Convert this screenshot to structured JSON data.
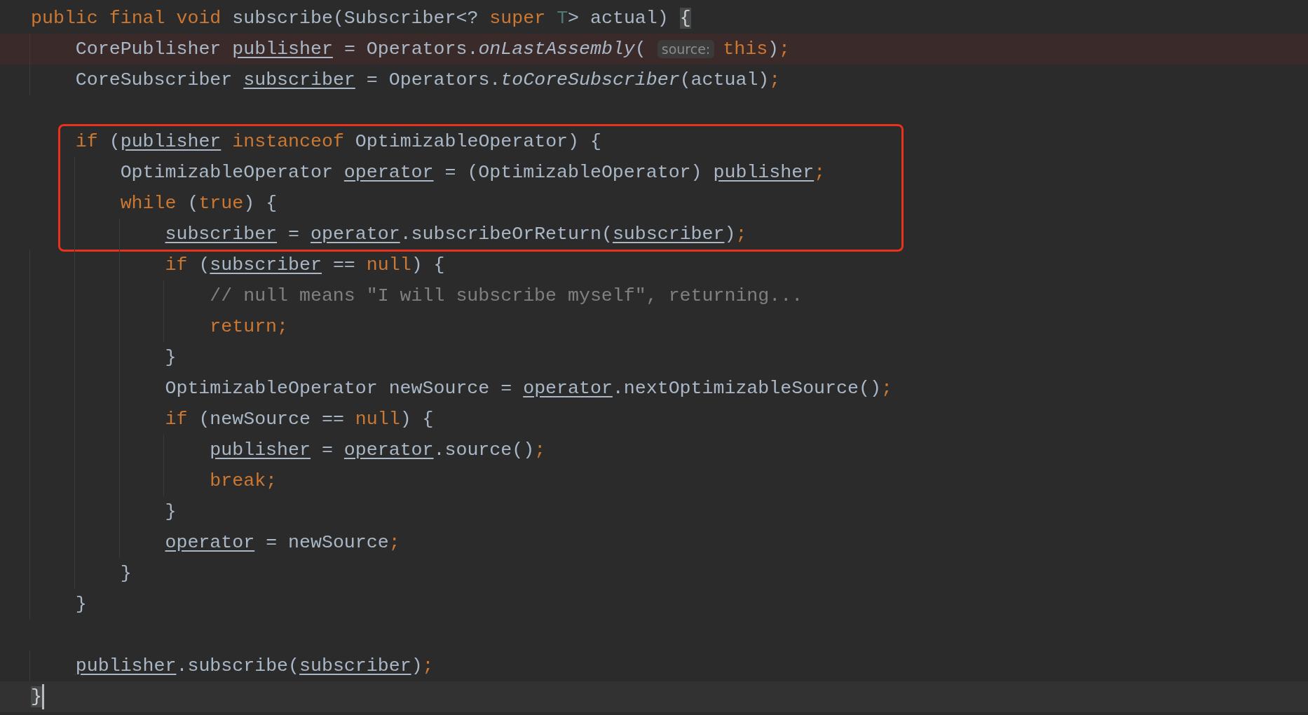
{
  "editor": {
    "lines": [
      {
        "kind": "code",
        "tokens": [
          {
            "kind": "keyword",
            "text": "public final void"
          },
          {
            "kind": "plain",
            "text": " subscribe(Subscriber<? "
          },
          {
            "kind": "keyword",
            "text": "super"
          },
          {
            "kind": "type-param",
            "text": " T"
          },
          {
            "kind": "plain",
            "text": "> actual) "
          },
          {
            "kind": "brace-match",
            "text": "{"
          }
        ],
        "children": [
          {
            "kind": "code",
            "marked": true,
            "tokens": [
              {
                "kind": "plain",
                "text": "CorePublisher "
              },
              {
                "kind": "local",
                "text": "publisher"
              },
              {
                "kind": "plain",
                "text": " = Operators."
              },
              {
                "kind": "static-call",
                "text": "onLastAssembly"
              },
              {
                "kind": "plain",
                "text": "( "
              },
              {
                "kind": "hint",
                "text": "source:"
              },
              {
                "kind": "keyword",
                "text": "this"
              },
              {
                "kind": "plain",
                "text": ")"
              },
              {
                "kind": "semicolon",
                "text": ";"
              }
            ]
          },
          {
            "kind": "code",
            "tokens": [
              {
                "kind": "plain",
                "text": "CoreSubscriber "
              },
              {
                "kind": "local",
                "text": "subscriber"
              },
              {
                "kind": "plain",
                "text": " = Operators."
              },
              {
                "kind": "static-call",
                "text": "toCoreSubscriber"
              },
              {
                "kind": "plain",
                "text": "(actual)"
              },
              {
                "kind": "semicolon",
                "text": ";"
              }
            ]
          },
          {
            "kind": "blank"
          },
          {
            "kind": "code",
            "boxed": true,
            "tokens": [
              {
                "kind": "keyword",
                "text": "if"
              },
              {
                "kind": "plain",
                "text": " ("
              },
              {
                "kind": "local",
                "text": "publisher"
              },
              {
                "kind": "keyword",
                "text": " instanceof"
              },
              {
                "kind": "plain",
                "text": " OptimizableOperator) {"
              }
            ],
            "children": [
              {
                "kind": "code",
                "boxed": true,
                "tokens": [
                  {
                    "kind": "plain",
                    "text": "OptimizableOperator "
                  },
                  {
                    "kind": "local",
                    "text": "operator"
                  },
                  {
                    "kind": "plain",
                    "text": " = (OptimizableOperator) "
                  },
                  {
                    "kind": "local",
                    "text": "publisher"
                  },
                  {
                    "kind": "semicolon",
                    "text": ";"
                  }
                ]
              },
              {
                "kind": "code",
                "boxed": true,
                "tokens": [
                  {
                    "kind": "keyword",
                    "text": "while"
                  },
                  {
                    "kind": "plain",
                    "text": " ("
                  },
                  {
                    "kind": "keyword",
                    "text": "true"
                  },
                  {
                    "kind": "plain",
                    "text": ") {"
                  }
                ],
                "children": [
                  {
                    "kind": "code",
                    "boxed": true,
                    "tokens": [
                      {
                        "kind": "local",
                        "text": "subscriber"
                      },
                      {
                        "kind": "plain",
                        "text": " = "
                      },
                      {
                        "kind": "local",
                        "text": "operator"
                      },
                      {
                        "kind": "plain",
                        "text": ".subscribeOrReturn("
                      },
                      {
                        "kind": "local",
                        "text": "subscriber"
                      },
                      {
                        "kind": "plain",
                        "text": ")"
                      },
                      {
                        "kind": "semicolon",
                        "text": ";"
                      }
                    ]
                  },
                  {
                    "kind": "code",
                    "tokens": [
                      {
                        "kind": "keyword",
                        "text": "if"
                      },
                      {
                        "kind": "plain",
                        "text": " ("
                      },
                      {
                        "kind": "local",
                        "text": "subscriber"
                      },
                      {
                        "kind": "plain",
                        "text": " == "
                      },
                      {
                        "kind": "keyword",
                        "text": "null"
                      },
                      {
                        "kind": "plain",
                        "text": ") {"
                      }
                    ],
                    "children": [
                      {
                        "kind": "code",
                        "tokens": [
                          {
                            "kind": "comment",
                            "text": "// null means \"I will subscribe myself\", returning..."
                          }
                        ]
                      },
                      {
                        "kind": "code",
                        "tokens": [
                          {
                            "kind": "keyword",
                            "text": "return"
                          },
                          {
                            "kind": "semicolon",
                            "text": ";"
                          }
                        ]
                      }
                    ]
                  },
                  {
                    "kind": "code",
                    "tokens": [
                      {
                        "kind": "plain",
                        "text": "}"
                      }
                    ]
                  },
                  {
                    "kind": "code",
                    "tokens": [
                      {
                        "kind": "plain",
                        "text": "OptimizableOperator newSource = "
                      },
                      {
                        "kind": "local",
                        "text": "operator"
                      },
                      {
                        "kind": "plain",
                        "text": ".nextOptimizableSource()"
                      },
                      {
                        "kind": "semicolon",
                        "text": ";"
                      }
                    ]
                  },
                  {
                    "kind": "code",
                    "tokens": [
                      {
                        "kind": "keyword",
                        "text": "if"
                      },
                      {
                        "kind": "plain",
                        "text": " (newSource == "
                      },
                      {
                        "kind": "keyword",
                        "text": "null"
                      },
                      {
                        "kind": "plain",
                        "text": ") {"
                      }
                    ],
                    "children": [
                      {
                        "kind": "code",
                        "tokens": [
                          {
                            "kind": "local",
                            "text": "publisher"
                          },
                          {
                            "kind": "plain",
                            "text": " = "
                          },
                          {
                            "kind": "local",
                            "text": "operator"
                          },
                          {
                            "kind": "plain",
                            "text": ".source()"
                          },
                          {
                            "kind": "semicolon",
                            "text": ";"
                          }
                        ]
                      },
                      {
                        "kind": "code",
                        "tokens": [
                          {
                            "kind": "keyword",
                            "text": "break"
                          },
                          {
                            "kind": "semicolon",
                            "text": ";"
                          }
                        ]
                      }
                    ]
                  },
                  {
                    "kind": "code",
                    "tokens": [
                      {
                        "kind": "plain",
                        "text": "}"
                      }
                    ]
                  },
                  {
                    "kind": "code",
                    "tokens": [
                      {
                        "kind": "local",
                        "text": "operator"
                      },
                      {
                        "kind": "plain",
                        "text": " = newSource"
                      },
                      {
                        "kind": "semicolon",
                        "text": ";"
                      }
                    ]
                  }
                ]
              },
              {
                "kind": "code",
                "tokens": [
                  {
                    "kind": "plain",
                    "text": "}"
                  }
                ]
              }
            ]
          },
          {
            "kind": "code",
            "tokens": [
              {
                "kind": "plain",
                "text": "}"
              }
            ]
          },
          {
            "kind": "blank"
          },
          {
            "kind": "code",
            "tokens": [
              {
                "kind": "local",
                "text": "publisher"
              },
              {
                "kind": "plain",
                "text": ".subscribe("
              },
              {
                "kind": "local",
                "text": "subscriber"
              },
              {
                "kind": "plain",
                "text": ")"
              },
              {
                "kind": "semicolon",
                "text": ";"
              }
            ]
          }
        ]
      },
      {
        "kind": "code",
        "current": true,
        "tokens": [
          {
            "kind": "brace-match",
            "text": "}"
          }
        ]
      }
    ]
  }
}
